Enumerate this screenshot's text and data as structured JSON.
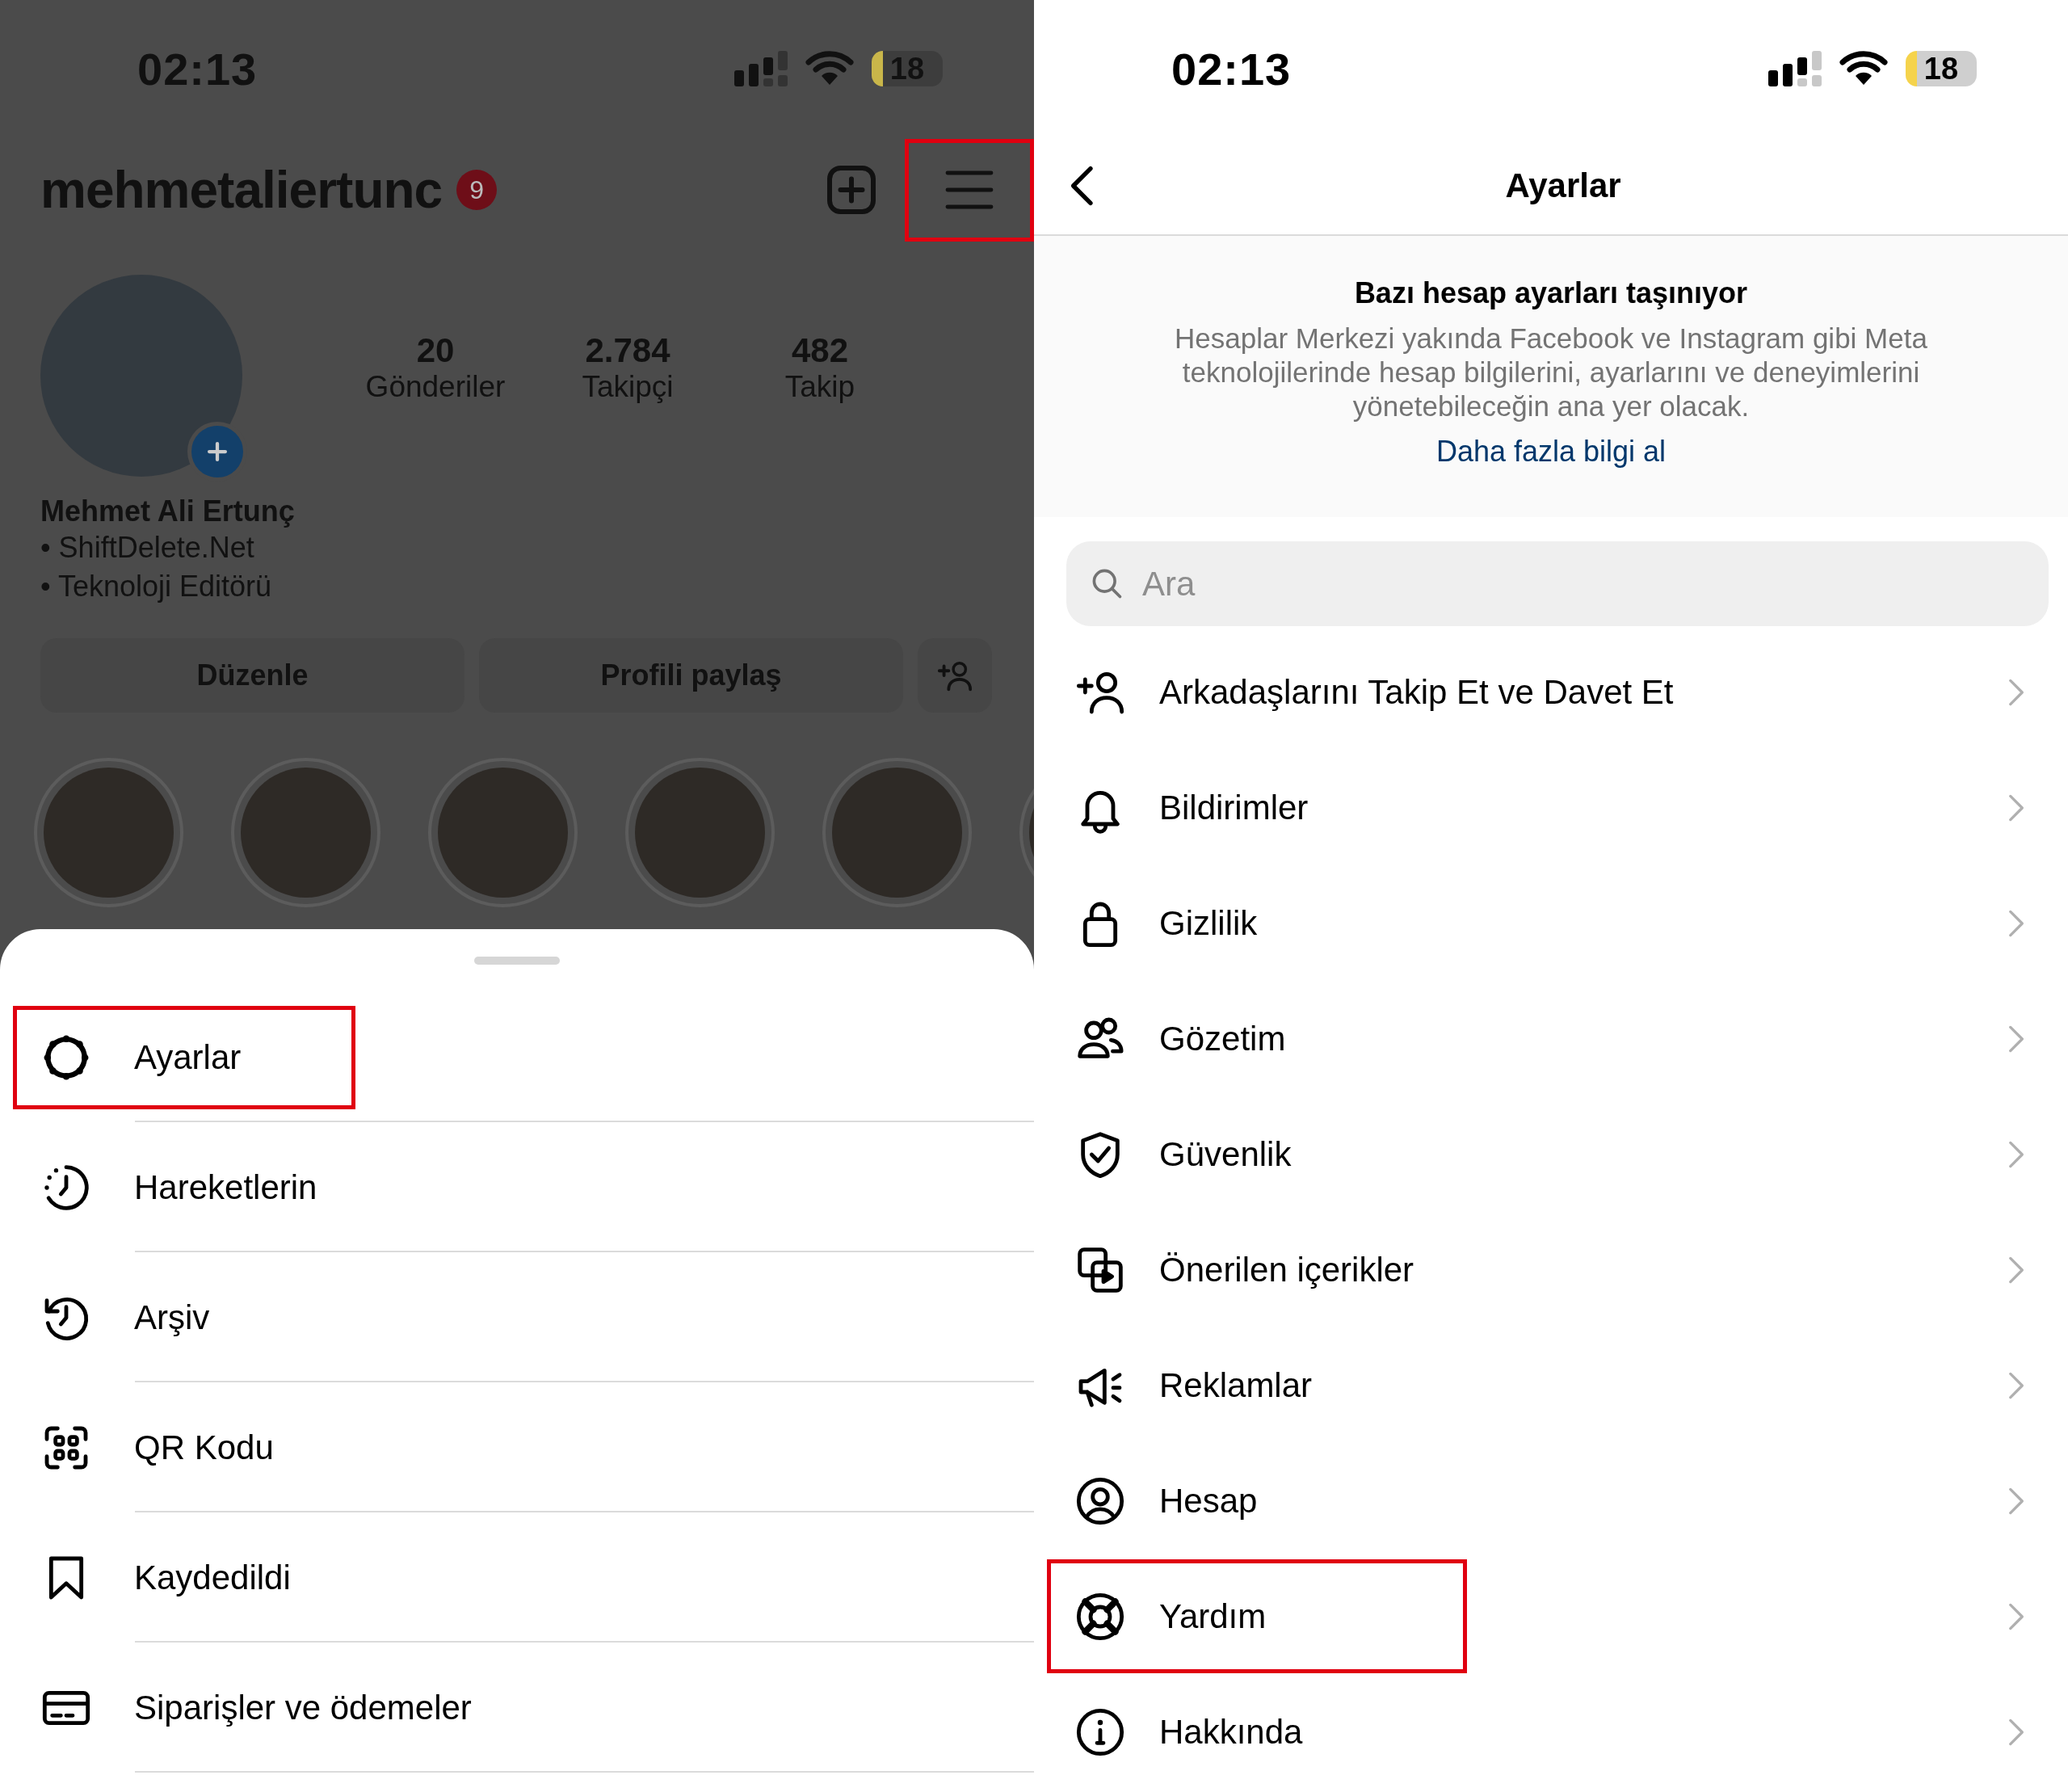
{
  "profile_screen": {
    "status_bar": {
      "time": "02:13",
      "battery": "18"
    },
    "header": {
      "username": "mehmetaliertunc",
      "notification_count": "9",
      "menu_highlighted": true
    },
    "stats": [
      {
        "value": "20",
        "label": "Gönderiler"
      },
      {
        "value": "2.784",
        "label": "Takipçi"
      },
      {
        "value": "482",
        "label": "Takip"
      }
    ],
    "name": "Mehmet Ali Ertunç",
    "bio_lines": [
      "• ShiftDelete.Net",
      "• Teknoloji Editörü"
    ],
    "buttons": [
      "Düzenle",
      "Profili paylaş"
    ],
    "highlights": [
      {
        "kind": "photo"
      },
      {
        "kind": "photo"
      },
      {
        "kind": "photo"
      },
      {
        "kind": "photo"
      },
      {
        "kind": "photo"
      },
      {
        "kind": "photo"
      }
    ],
    "menu_items": [
      {
        "label": "Ayarlar",
        "highlighted": true
      },
      {
        "label": "Hareketlerin",
        "highlighted": false
      },
      {
        "label": "Arşiv",
        "highlighted": false
      },
      {
        "label": "QR Kodu",
        "highlighted": false
      },
      {
        "label": "Kaydedildi",
        "highlighted": false
      },
      {
        "label": "Siparişler ve ödemeler",
        "highlighted": false
      }
    ]
  },
  "settings_screen": {
    "status_bar": {
      "time": "02:13",
      "battery": "18"
    },
    "header": {
      "title": "Ayarlar"
    },
    "notice": {
      "title": "Bazı hesap ayarları taşınıyor",
      "body": "Hesaplar Merkezi yakında Facebook ve Instagram gibi Meta teknolojilerinde hesap bilgilerini, ayarlarını ve deneyimlerini yönetebileceğin ana yer olacak.",
      "link": "Daha fazla bilgi al"
    },
    "search": {
      "placeholder": "Ara"
    },
    "items": [
      {
        "label": "Arkadaşlarını Takip Et ve Davet Et",
        "highlighted": false
      },
      {
        "label": "Bildirimler",
        "highlighted": false
      },
      {
        "label": "Gizlilik",
        "highlighted": false
      },
      {
        "label": "Gözetim",
        "highlighted": false
      },
      {
        "label": "Güvenlik",
        "highlighted": false
      },
      {
        "label": "Önerilen içerikler",
        "highlighted": false
      },
      {
        "label": "Reklamlar",
        "highlighted": false
      },
      {
        "label": "Hesap",
        "highlighted": false
      },
      {
        "label": "Yardım",
        "highlighted": true
      },
      {
        "label": "Hakkında",
        "highlighted": false
      }
    ]
  }
}
